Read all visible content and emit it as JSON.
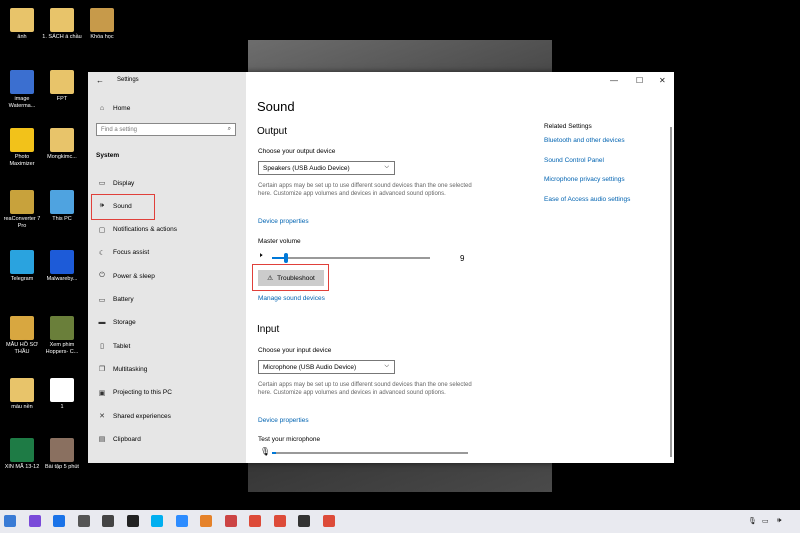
{
  "desktop_icons": [
    {
      "label": "ảnh",
      "color": "#e8c46a"
    },
    {
      "label": "1. SÁCH á chầu",
      "color": "#e8c46a"
    },
    {
      "label": "Khóa học",
      "color": "#c79a4a"
    },
    {
      "label": "image Waterma...",
      "color": "#3b6fd0"
    },
    {
      "label": "FPT",
      "color": "#e8c46a"
    },
    {
      "label": "Photo Maximizer",
      "color": "#f2c21a"
    },
    {
      "label": "Mongkimc...",
      "color": "#e8c46a"
    },
    {
      "label": "reaConverter 7 Pro",
      "color": "#c8a23c"
    },
    {
      "label": "This PC",
      "color": "#4fa3e0"
    },
    {
      "label": "Telegram",
      "color": "#2aa3df"
    },
    {
      "label": "Malwareby...",
      "color": "#1d5bd8"
    },
    {
      "label": "MẪU HỒ SƠ THẦU",
      "color": "#d8a740"
    },
    {
      "label": "Xem phim Hoppers- C...",
      "color": "#6a7f3a"
    },
    {
      "label": "màu nền",
      "color": "#e8c46a"
    },
    {
      "label": "1",
      "color": "#ffffff"
    },
    {
      "label": "XIN MÃ 13-12",
      "color": "#1e7b45"
    },
    {
      "label": "Bài tập 5 phút",
      "color": "#8a7060"
    }
  ],
  "window": {
    "app_title": "Settings",
    "minimize": "—",
    "maximize": "☐",
    "close": "✕",
    "back_glyph": "←"
  },
  "sidebar": {
    "home": "Home",
    "search_placeholder": "Find a setting",
    "section": "System",
    "items": [
      {
        "label": "Display",
        "icon": "display-icon",
        "glyph": "▭"
      },
      {
        "label": "Sound",
        "icon": "speaker-icon",
        "glyph": "🕪"
      },
      {
        "label": "Notifications & actions",
        "icon": "notifications-icon",
        "glyph": "▢"
      },
      {
        "label": "Focus assist",
        "icon": "moon-icon",
        "glyph": "☾"
      },
      {
        "label": "Power & sleep",
        "icon": "power-icon",
        "glyph": "⏻"
      },
      {
        "label": "Battery",
        "icon": "battery-icon",
        "glyph": "▭"
      },
      {
        "label": "Storage",
        "icon": "storage-icon",
        "glyph": "▬"
      },
      {
        "label": "Tablet",
        "icon": "tablet-icon",
        "glyph": "▯"
      },
      {
        "label": "Multitasking",
        "icon": "multitasking-icon",
        "glyph": "❐"
      },
      {
        "label": "Projecting to this PC",
        "icon": "projecting-icon",
        "glyph": "▣"
      },
      {
        "label": "Shared experiences",
        "icon": "shared-icon",
        "glyph": "✕"
      },
      {
        "label": "Clipboard",
        "icon": "clipboard-icon",
        "glyph": "▤"
      }
    ]
  },
  "content": {
    "title": "Sound",
    "output": {
      "heading": "Output",
      "device_label": "Choose your output device",
      "device_value": "Speakers (USB Audio Device)",
      "description": "Certain apps may be set up to use different sound devices than the one selected here. Customize app volumes and devices in advanced sound options.",
      "device_properties": "Device properties",
      "volume_label": "Master volume",
      "volume_value": "9",
      "volume_fraction": 0.09,
      "troubleshoot": "Troubleshoot",
      "manage": "Manage sound devices"
    },
    "input": {
      "heading": "Input",
      "device_label": "Choose your input device",
      "device_value": "Microphone (USB Audio Device)",
      "description": "Certain apps may be set up to use different sound devices than the one selected here. Customize app volumes and devices in advanced sound options.",
      "device_properties": "Device properties",
      "test_label": "Test your microphone"
    },
    "related": {
      "heading": "Related Settings",
      "links": [
        "Bluetooth and other devices",
        "Sound Control Panel",
        "Microphone privacy settings",
        "Ease of Access audio settings"
      ]
    }
  },
  "taskbar": {
    "apps": [
      {
        "name": "remote-app",
        "color": "#3a7bd5"
      },
      {
        "name": "pen-app",
        "color": "#7a4ad9"
      },
      {
        "name": "zalo-app",
        "color": "#1a73e8"
      },
      {
        "name": "photos-app",
        "color": "#555555"
      },
      {
        "name": "checklist-app",
        "color": "#444444"
      },
      {
        "name": "capcut-app",
        "color": "#222222"
      },
      {
        "name": "skype-app",
        "color": "#00aff0"
      },
      {
        "name": "zoom-app",
        "color": "#2d8cff"
      },
      {
        "name": "office-app",
        "color": "#e5822a"
      },
      {
        "name": "recorder-app",
        "color": "#c44"
      },
      {
        "name": "chrome-app",
        "color": "#dd4b39"
      },
      {
        "name": "chrome-app-2",
        "color": "#dd4b39"
      },
      {
        "name": "settings-app",
        "color": "#333333"
      },
      {
        "name": "chrome-app-3",
        "color": "#dd4b39"
      }
    ]
  }
}
